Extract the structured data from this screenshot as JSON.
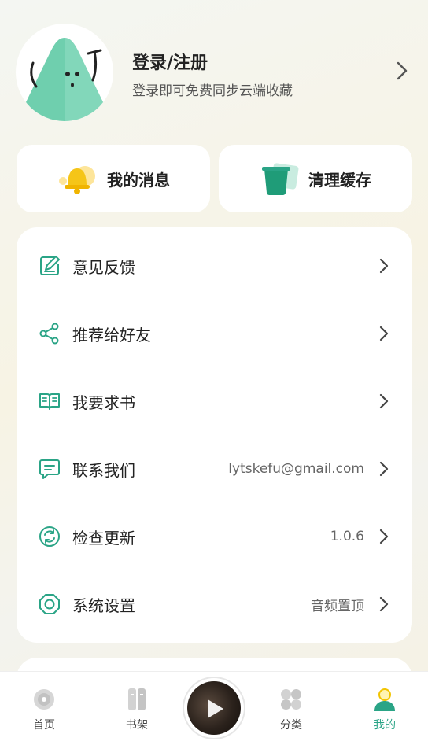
{
  "profile": {
    "title": "登录/注册",
    "subtitle": "登录即可免费同步云端收藏",
    "avatar_icon": "mascot-avatar"
  },
  "quick": {
    "messages_label": "我的消息",
    "messages_icon": "bell-icon",
    "cache_label": "清理缓存",
    "cache_icon": "trash-icon"
  },
  "menu": {
    "items": [
      {
        "label": "意见反馈",
        "value": "",
        "icon": "edit-icon"
      },
      {
        "label": "推荐给好友",
        "value": "",
        "icon": "share-icon"
      },
      {
        "label": "我要求书",
        "value": "",
        "icon": "book-icon"
      },
      {
        "label": "联系我们",
        "value": "lytskefu@gmail.com",
        "icon": "message-icon"
      },
      {
        "label": "检查更新",
        "value": "1.0.6",
        "icon": "refresh-icon"
      },
      {
        "label": "系统设置",
        "value": "音频置顶",
        "icon": "settings-icon"
      }
    ]
  },
  "nav": {
    "items": [
      {
        "label": "首页",
        "icon": "disc-icon",
        "active": false
      },
      {
        "label": "书架",
        "icon": "bookshelf-icon",
        "active": false
      },
      {
        "label": "分类",
        "icon": "grid-icon",
        "active": false
      },
      {
        "label": "我的",
        "icon": "user-icon",
        "active": true
      }
    ]
  },
  "colors": {
    "accent": "#2aa486",
    "bell": "#f5c518",
    "text": "#222222",
    "muted": "#666666"
  }
}
